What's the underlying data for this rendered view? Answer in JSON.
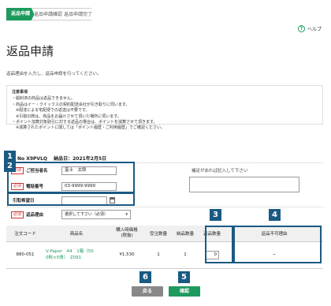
{
  "steps": [
    "返品申請",
    "返品申請確認",
    "返品申請完了"
  ],
  "help_label": "ヘルプ",
  "page_title": "返品申請",
  "subtitle": "返品理由を入力し、返品申請を行ってください。",
  "notes": {
    "heading": "注意事項",
    "lines": [
      "・開封済の商品は返品できません。",
      "・商品はイー・クイックスの契約配送会社が引き取りに伺います。",
      "　※配達による宅配便での返送は不要です。",
      "　※引取の際は、商品をお届けさせて頂いた場所に伺います。",
      "・ポイント加算対象取引に対する返品の場合は、ポイントを減算させて頂きます。",
      "　※減算されたポイントに関しては「ポイント履歴・ご利用履歴」でご確認ください。"
    ]
  },
  "order": {
    "number_text": "No X9PVLQ",
    "date_text": "納品日：2021年2月5日"
  },
  "form": {
    "required_tag": "必須",
    "orderer_label": "ご担当者名",
    "orderer_value": "富士　太郎",
    "phone_label": "電話番号",
    "phone_value": "03-9999-9999",
    "pickup_label": "引取希望日",
    "reason_label": "返品理由",
    "reason_value": "選択して下さい（必須）",
    "memo_hint": "補足があれば記入して下さい"
  },
  "table": {
    "headers": [
      "注文コード",
      "商品名",
      "購入時価格\n(税抜)",
      "受注数量",
      "納品数量",
      "返品数量",
      "返品不可理由"
    ],
    "row": {
      "code": "880-051",
      "name_line1": "V-Paper　A4　1箱（50",
      "name_line2": "0枚×5冊）　Z091",
      "price": "¥1,530",
      "ordered": "1",
      "delivered": "1",
      "return_qty": "0",
      "reason": "−"
    }
  },
  "buttons": {
    "back": "戻る",
    "confirm": "確認"
  },
  "badges": [
    "1",
    "2",
    "3",
    "4",
    "5",
    "6"
  ],
  "colors": {
    "accent": "#1f9a5e",
    "annotation": "#1a5a82",
    "required": "#cc3333",
    "back_button": "#888888"
  }
}
